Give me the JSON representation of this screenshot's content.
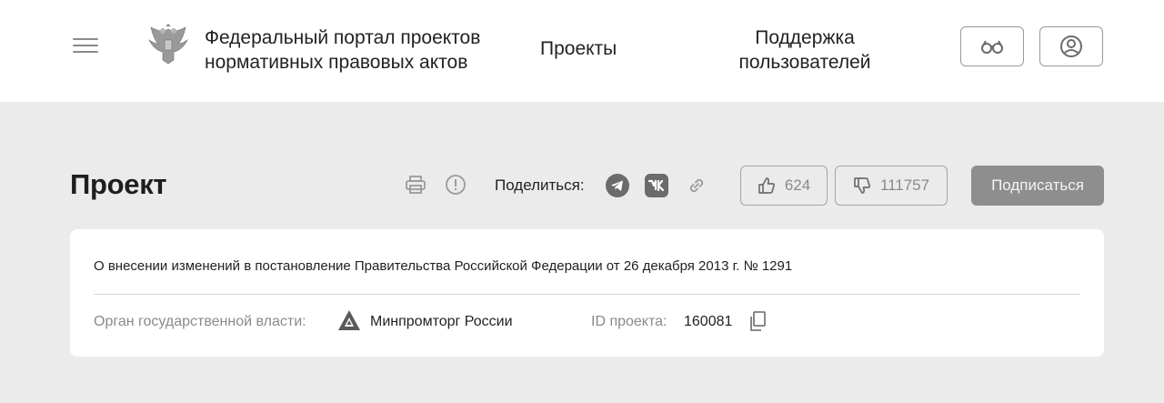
{
  "header": {
    "site_title_line1": "Федеральный портал проектов",
    "site_title_line2": "нормативных правовых актов",
    "nav_projects": "Проекты",
    "nav_support_line1": "Поддержка",
    "nav_support_line2": "пользователей",
    "icons": {
      "menu": "hamburger-icon",
      "emblem": "coat-of-arms-icon",
      "accessibility": "glasses-icon",
      "account": "user-icon"
    }
  },
  "toolbar": {
    "page_title": "Проект",
    "share_label": "Поделиться:",
    "likes": "624",
    "dislikes": "111757",
    "subscribe_label": "Подписаться",
    "icons": {
      "print": "print-icon",
      "report": "alert-icon",
      "telegram": "telegram-icon",
      "vk": "vk-icon",
      "link": "link-icon",
      "like": "thumbs-up-icon",
      "dislike": "thumbs-down-icon"
    }
  },
  "project": {
    "description": "О внесении изменений в постановление Правительства Российской Федерации от 26 декабря 2013 г. № 1291",
    "authority_label": "Орган государственной власти:",
    "authority_name": "Минпромторг России",
    "id_label": "ID проекта:",
    "id_value": "160081",
    "icons": {
      "authority": "ministry-logo-icon",
      "copy": "copy-icon"
    }
  },
  "colors": {
    "page_background": "#ebebeb",
    "header_background": "#ffffff",
    "primary_text": "#222222",
    "muted_text": "#8a8a8a",
    "subscribe_button": "#8e8e8e"
  }
}
